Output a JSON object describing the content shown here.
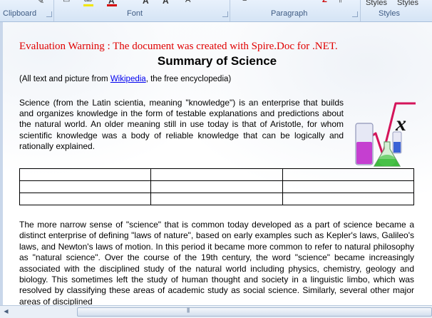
{
  "ribbon": {
    "groups": {
      "clipboard": "Clipboard",
      "font": "Font",
      "paragraph": "Paragraph",
      "styles": "Styles"
    },
    "styles_buttons": [
      "Styles",
      "Styles"
    ],
    "font_glyphs": [
      "A",
      "A",
      "A",
      "A"
    ],
    "sort_glyph": "Z",
    "colors": {
      "highlight": "#f2e600",
      "font_color": "#d40000"
    }
  },
  "document": {
    "evaluation_warning": "Evaluation Warning : The document was created with Spire.Doc for .NET.",
    "title": "Summary of Science",
    "source_prefix": "(All text and picture from ",
    "source_link": "Wikipedia",
    "source_suffix": ", the free encyclopedia)",
    "paragraph1": "Science (from the Latin scientia, meaning \"knowledge\") is an enterprise that builds and organizes knowledge in the form of testable explanations and predictions about the natural world. An older meaning still in use today is that of Aristotle, for whom scientific knowledge was a body of reliable knowledge that can be logically and rationally explained.",
    "table": {
      "rows": [
        [
          "",
          "",
          ""
        ],
        [
          "",
          "",
          ""
        ],
        [
          "",
          "",
          ""
        ]
      ]
    },
    "paragraph2": "The more narrow sense of \"science\" that is common today developed as a part of science became a distinct enterprise of defining \"laws of nature\", based on early examples such as Kepler's laws, Galileo's laws, and Newton's laws of motion. In this period it became more common to refer to natural philosophy as \"natural science\". Over the course of the 19th century, the word \"science\" became increasingly associated with the disciplined study of the natural world including physics, chemistry, geology and biology. This sometimes left the study of human thought and society in a linguistic limbo, which was resolved by classifying these areas of academic study as social science. Similarly, several other major areas of disciplined"
  },
  "colors": {
    "warning": "#e00000",
    "link": "#0000ee",
    "ribbon_bg": "#d5e4f5"
  }
}
